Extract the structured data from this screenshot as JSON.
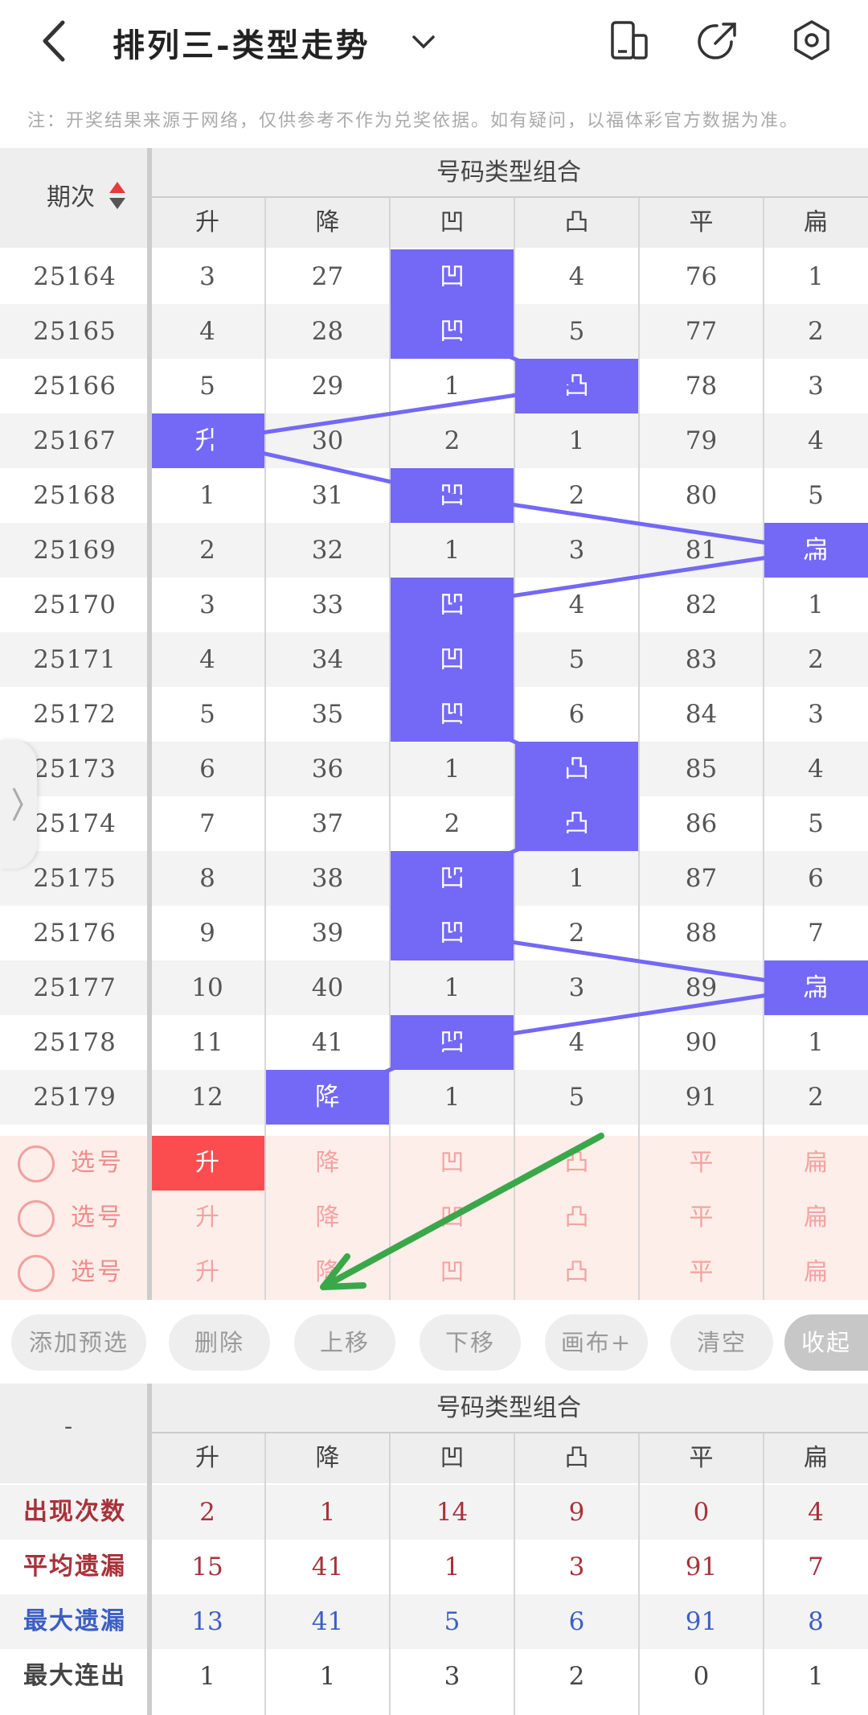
{
  "header": {
    "title": "排列三-类型走势",
    "icons": [
      "back-arrow-icon",
      "chevron-down-icon",
      "phone-layout-icon",
      "share-icon",
      "settings-icon"
    ]
  },
  "notice": "注：开奖结果来源于网络，仅供参考不作为兑奖依据。如有疑问，以福体彩官方数据为准。",
  "trend": {
    "period_label": "期次",
    "group_label": "号码类型组合",
    "columns": [
      "升",
      "降",
      "凹",
      "凸",
      "平",
      "扁"
    ],
    "rows": [
      {
        "period": "25164",
        "values": [
          "3",
          "27",
          "凹",
          "4",
          "76",
          "1"
        ],
        "hit": 2
      },
      {
        "period": "25165",
        "values": [
          "4",
          "28",
          "凹",
          "5",
          "77",
          "2"
        ],
        "hit": 2
      },
      {
        "period": "25166",
        "values": [
          "5",
          "29",
          "1",
          "凸",
          "78",
          "3"
        ],
        "hit": 3
      },
      {
        "period": "25167",
        "values": [
          "升",
          "30",
          "2",
          "1",
          "79",
          "4"
        ],
        "hit": 0
      },
      {
        "period": "25168",
        "values": [
          "1",
          "31",
          "凹",
          "2",
          "80",
          "5"
        ],
        "hit": 2
      },
      {
        "period": "25169",
        "values": [
          "2",
          "32",
          "1",
          "3",
          "81",
          "扁"
        ],
        "hit": 5
      },
      {
        "period": "25170",
        "values": [
          "3",
          "33",
          "凹",
          "4",
          "82",
          "1"
        ],
        "hit": 2
      },
      {
        "period": "25171",
        "values": [
          "4",
          "34",
          "凹",
          "5",
          "83",
          "2"
        ],
        "hit": 2
      },
      {
        "period": "25172",
        "values": [
          "5",
          "35",
          "凹",
          "6",
          "84",
          "3"
        ],
        "hit": 2
      },
      {
        "period": "25173",
        "values": [
          "6",
          "36",
          "1",
          "凸",
          "85",
          "4"
        ],
        "hit": 3
      },
      {
        "period": "25174",
        "values": [
          "7",
          "37",
          "2",
          "凸",
          "86",
          "5"
        ],
        "hit": 3
      },
      {
        "period": "25175",
        "values": [
          "8",
          "38",
          "凹",
          "1",
          "87",
          "6"
        ],
        "hit": 2
      },
      {
        "period": "25176",
        "values": [
          "9",
          "39",
          "凹",
          "2",
          "88",
          "7"
        ],
        "hit": 2
      },
      {
        "period": "25177",
        "values": [
          "10",
          "40",
          "1",
          "3",
          "89",
          "扁"
        ],
        "hit": 5
      },
      {
        "period": "25178",
        "values": [
          "11",
          "41",
          "凹",
          "4",
          "90",
          "1"
        ],
        "hit": 2
      },
      {
        "period": "25179",
        "values": [
          "12",
          "降",
          "1",
          "5",
          "91",
          "2"
        ],
        "hit": 1
      }
    ]
  },
  "selection": {
    "label": "选号",
    "rows": [
      {
        "selected": 0
      },
      {
        "selected": -1
      },
      {
        "selected": -1
      }
    ]
  },
  "buttons": [
    "添加预选",
    "删除",
    "上移",
    "下移",
    "画布+",
    "清空",
    "收起"
  ],
  "stats": {
    "corner": "-",
    "group_label": "号码类型组合",
    "rows": [
      {
        "label": "出现次数",
        "values": [
          "2",
          "1",
          "14",
          "9",
          "0",
          "4"
        ],
        "color": "#a8323a"
      },
      {
        "label": "平均遗漏",
        "values": [
          "15",
          "41",
          "1",
          "3",
          "91",
          "7"
        ],
        "color": "#a8323a"
      },
      {
        "label": "最大遗漏",
        "values": [
          "13",
          "41",
          "5",
          "6",
          "91",
          "8"
        ],
        "color": "#3c5fc4"
      },
      {
        "label": "最大连出",
        "values": [
          "1",
          "1",
          "3",
          "2",
          "0",
          "1"
        ],
        "color": "#444444"
      }
    ]
  },
  "colors": {
    "hit": "#7468f6",
    "selected": "#fb4d50",
    "annotation_arrow": "#3aa84a"
  }
}
